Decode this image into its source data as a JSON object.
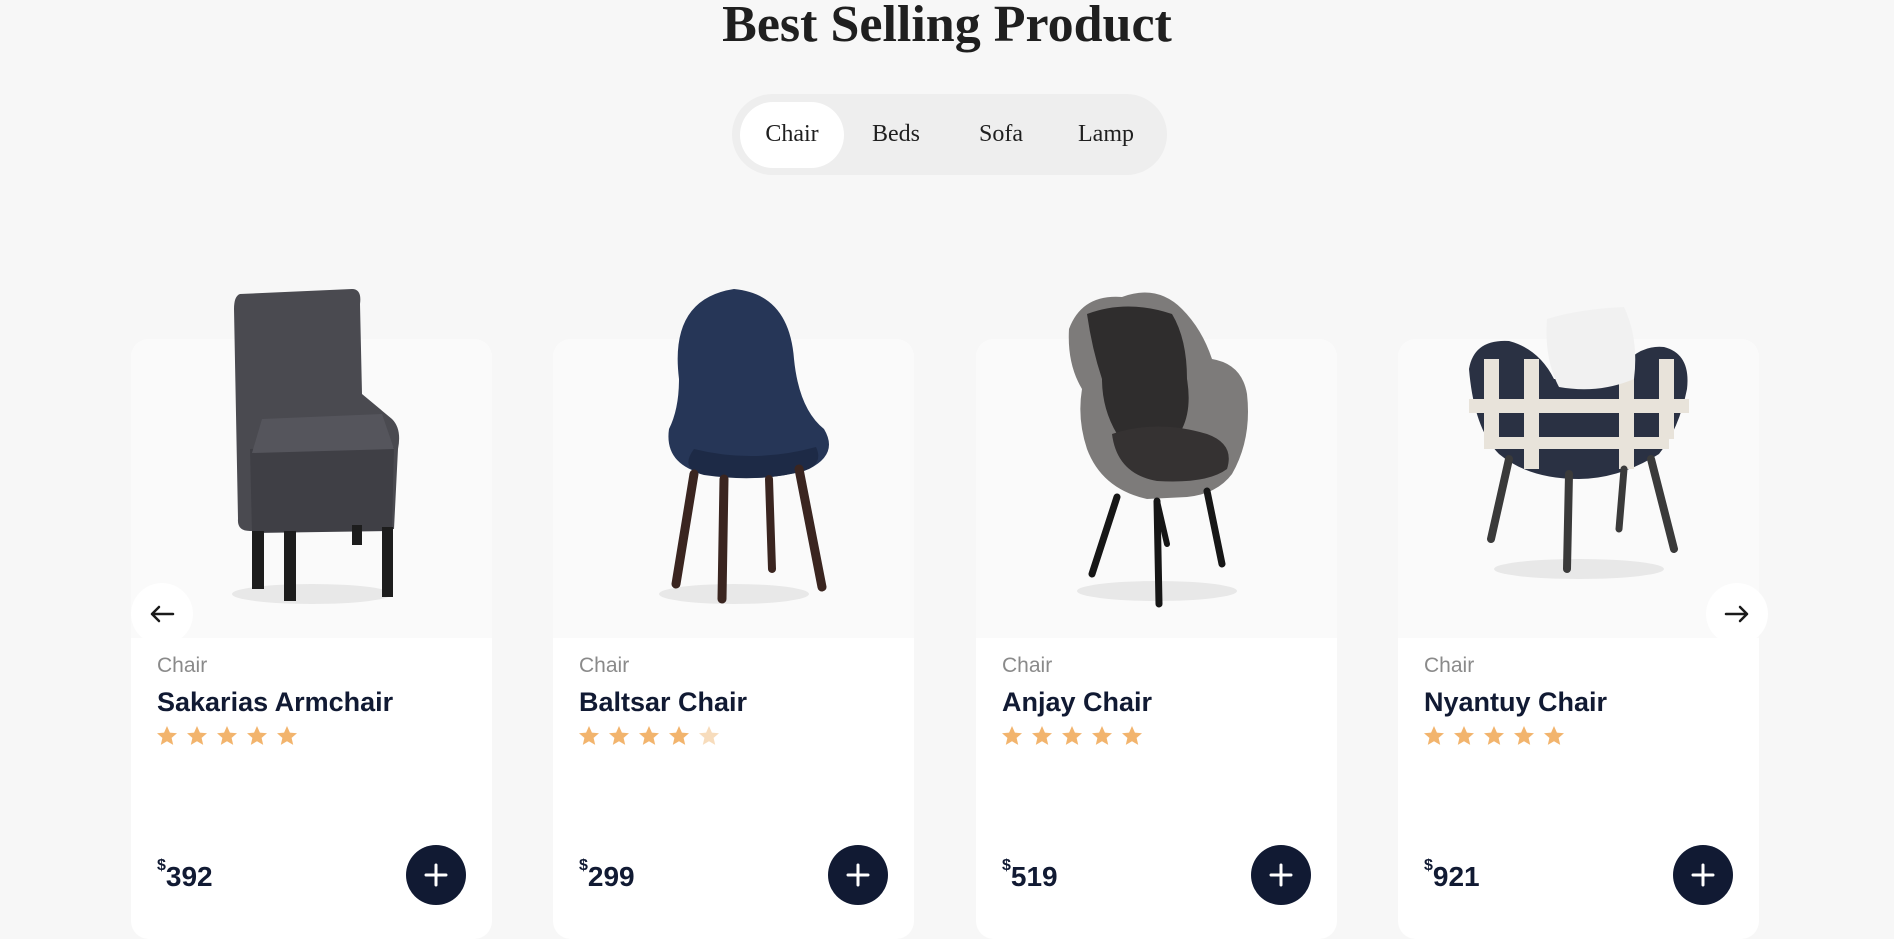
{
  "header": {
    "title": "Best Selling Product"
  },
  "tabs": [
    {
      "label": "Chair",
      "active": true
    },
    {
      "label": "Beds",
      "active": false
    },
    {
      "label": "Sofa",
      "active": false
    },
    {
      "label": "Lamp",
      "active": false
    }
  ],
  "products": [
    {
      "category": "Chair",
      "name": "Sakarias Armchair",
      "rating": 5,
      "currency": "$",
      "price": "392",
      "image": "grey-armchair"
    },
    {
      "category": "Chair",
      "name": "Baltsar Chair",
      "rating": 4.5,
      "currency": "$",
      "price": "299",
      "image": "navy-shell-chair"
    },
    {
      "category": "Chair",
      "name": "Anjay Chair",
      "rating": 5,
      "currency": "$",
      "price": "519",
      "image": "leather-tub-chair"
    },
    {
      "category": "Chair",
      "name": "Nyantuy Chair",
      "rating": 5,
      "currency": "$",
      "price": "921",
      "image": "plaid-lounge-chair"
    }
  ],
  "icons": {
    "prev": "arrow-left-icon",
    "next": "arrow-right-icon",
    "add": "plus-icon",
    "star": "star-icon"
  },
  "colors": {
    "navy": "#111a33",
    "star": "#f2b46d",
    "background": "#f7f7f7"
  }
}
